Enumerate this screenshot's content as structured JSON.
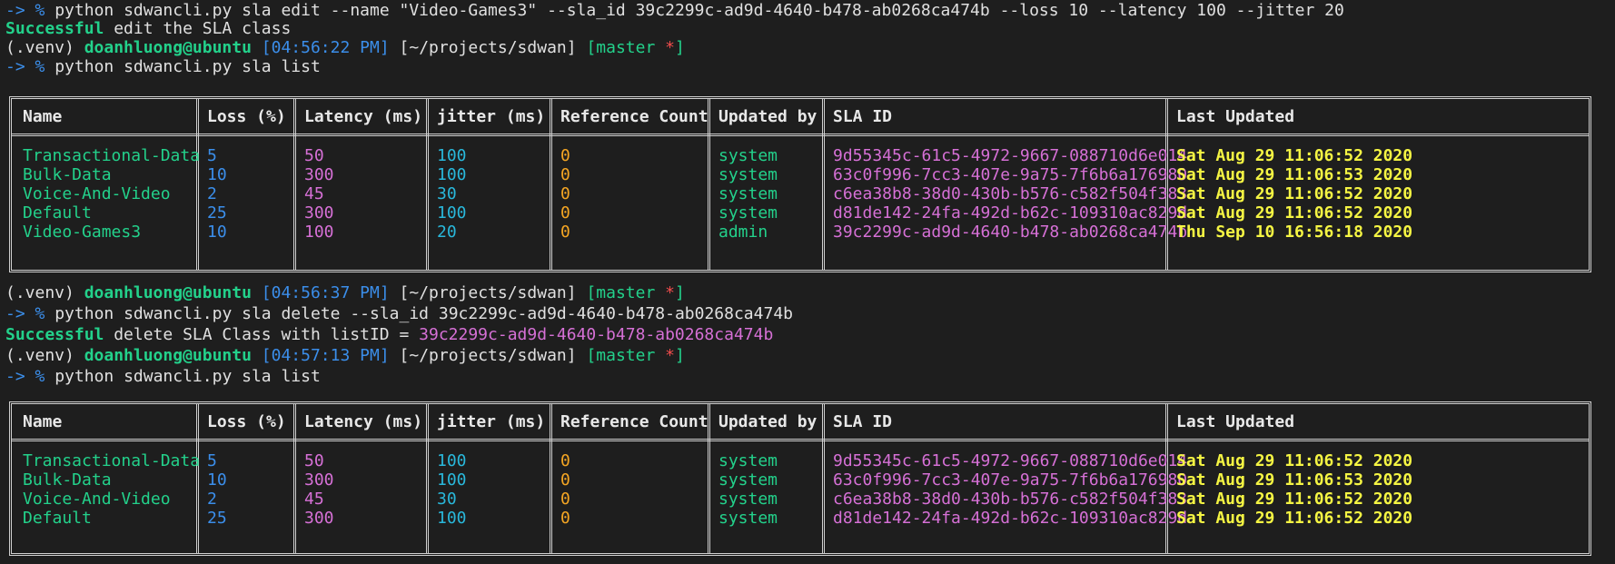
{
  "prompt_arrow": "->",
  "prompt_symbol": "%",
  "prompt": {
    "venv": "(.venv)",
    "user_host": "doanhluong@ubuntu",
    "path": "[~/projects/sdwan]",
    "branch_open": "[master ",
    "branch_star": "*",
    "branch_close": "]"
  },
  "lines": {
    "cmd1": "python sdwancli.py sla edit --name \"Video-Games3\" --sla_id 39c2299c-ad9d-4640-b478-ab0268ca474b --loss 10 --latency 100 --jitter 20",
    "success1_label": "Successful",
    "success1_text": " edit the SLA class",
    "time1": "[04:56:22 PM]",
    "cmd2": "python sdwancli.py sla list",
    "time2": "[04:56:37 PM]",
    "cmd3": "python sdwancli.py sla delete --sla_id 39c2299c-ad9d-4640-b478-ab0268ca474b",
    "success2_label": "Successful",
    "success2_text": " delete SLA Class with listID = ",
    "success2_id": "39c2299c-ad9d-4640-b478-ab0268ca474b",
    "time3": "[04:57:13 PM]",
    "cmd4": "python sdwancli.py sla list"
  },
  "table_headers": [
    "Name",
    "Loss (%)",
    "Latency (ms)",
    "jitter (ms)",
    "Reference Count",
    "Updated by",
    "SLA ID",
    "Last Updated"
  ],
  "table1_rows": [
    [
      "Transactional-Data",
      "5",
      "50",
      "100",
      "0",
      "system",
      "9d55345c-61c5-4972-9667-088710d6e014",
      "Sat Aug 29 11:06:52 2020"
    ],
    [
      "Bulk-Data",
      "10",
      "300",
      "100",
      "0",
      "system",
      "63c0f996-7cc3-407e-9a75-7f6b6a176980",
      "Sat Aug 29 11:06:53 2020"
    ],
    [
      "Voice-And-Video",
      "2",
      "45",
      "30",
      "0",
      "system",
      "c6ea38b8-38d0-430b-b576-c582f504f383",
      "Sat Aug 29 11:06:52 2020"
    ],
    [
      "Default",
      "25",
      "300",
      "100",
      "0",
      "system",
      "d81de142-24fa-492d-b62c-109310ac829d",
      "Sat Aug 29 11:06:52 2020"
    ],
    [
      "Video-Games3",
      "10",
      "100",
      "20",
      "0",
      "admin",
      "39c2299c-ad9d-4640-b478-ab0268ca474b",
      "Thu Sep 10 16:56:18 2020"
    ]
  ],
  "table2_rows": [
    [
      "Transactional-Data",
      "5",
      "50",
      "100",
      "0",
      "system",
      "9d55345c-61c5-4972-9667-088710d6e014",
      "Sat Aug 29 11:06:52 2020"
    ],
    [
      "Bulk-Data",
      "10",
      "300",
      "100",
      "0",
      "system",
      "63c0f996-7cc3-407e-9a75-7f6b6a176980",
      "Sat Aug 29 11:06:53 2020"
    ],
    [
      "Voice-And-Video",
      "2",
      "45",
      "30",
      "0",
      "system",
      "c6ea38b8-38d0-430b-b576-c582f504f383",
      "Sat Aug 29 11:06:52 2020"
    ],
    [
      "Default",
      "25",
      "300",
      "100",
      "0",
      "system",
      "d81de142-24fa-492d-b62c-109310ac829d",
      "Sat Aug 29 11:06:52 2020"
    ]
  ],
  "colors": {
    "background": "#1e1e1e",
    "green": "#23d18b",
    "blue": "#3b8eea",
    "magenta": "#d670d6",
    "cyan": "#29b8db",
    "orange": "#f5a623",
    "yellow": "#f5f543",
    "red": "#f14c4c"
  }
}
